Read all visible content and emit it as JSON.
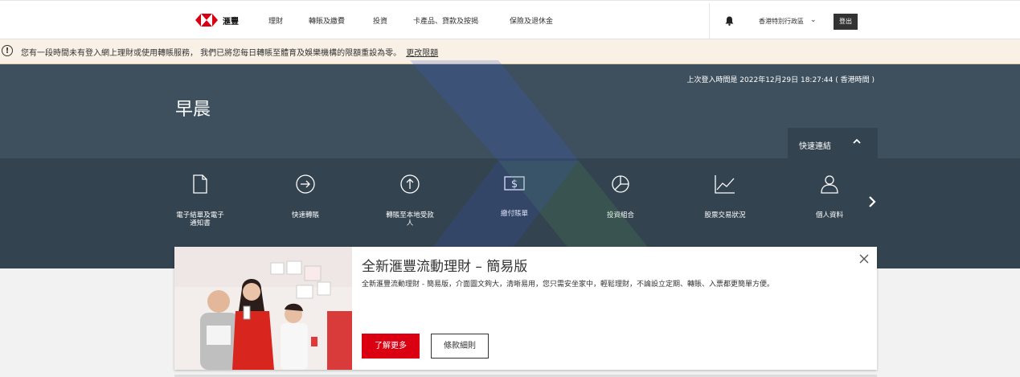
{
  "brand": {
    "name": "滙豐"
  },
  "nav": {
    "items": [
      "理財",
      "轉賬及繳費",
      "投資",
      "卡產品、貸款及按揭",
      "保險及退休金"
    ],
    "region": "香港特別行政區",
    "logout": "登出"
  },
  "warning": {
    "message": "您有一段時間未有登入網上理財或使用轉賬服務， 我們已將您每日轉賬至體育及娛樂機構的限額重設為零。",
    "link": "更改限額"
  },
  "header": {
    "last_login": "上次登入時間是 2022年12月29日 18:27:44 ( 香港時間 )",
    "greeting": "早晨",
    "quick_links_label": "快速連結"
  },
  "quick_links": [
    {
      "label_l1": "電子結單及電子",
      "label_l2": "通知書",
      "icon": "document-icon"
    },
    {
      "label_l1": "快速轉賬",
      "label_l2": "",
      "icon": "arrow-circle-right-icon"
    },
    {
      "label_l1": "轉賬至本地受款",
      "label_l2": "人",
      "icon": "arrow-circle-up-icon"
    },
    {
      "label_l1": "繳付賬單",
      "label_l2": "",
      "icon": "dollar-bill-icon"
    },
    {
      "label_l1": "投資組合",
      "label_l2": "",
      "icon": "pie-chart-icon"
    },
    {
      "label_l1": "股票交易狀況",
      "label_l2": "",
      "icon": "line-chart-icon"
    },
    {
      "label_l1": "個人資料",
      "label_l2": "",
      "icon": "person-icon"
    }
  ],
  "promo": {
    "title": "全新滙豐流動理財 – 簡易版",
    "body": "全新滙豐流動理財 - 簡易版，介面圖文夠大，清晰易用，您只需安坐家中，輕鬆理財，不論設立定期、轉賬、入票都更簡單方便。",
    "primary_button": "了解更多",
    "secondary_button": "條款細則"
  },
  "colors": {
    "brand_red": "#db0011",
    "header_dark": "#3e505d",
    "band_dark": "#33434f"
  }
}
